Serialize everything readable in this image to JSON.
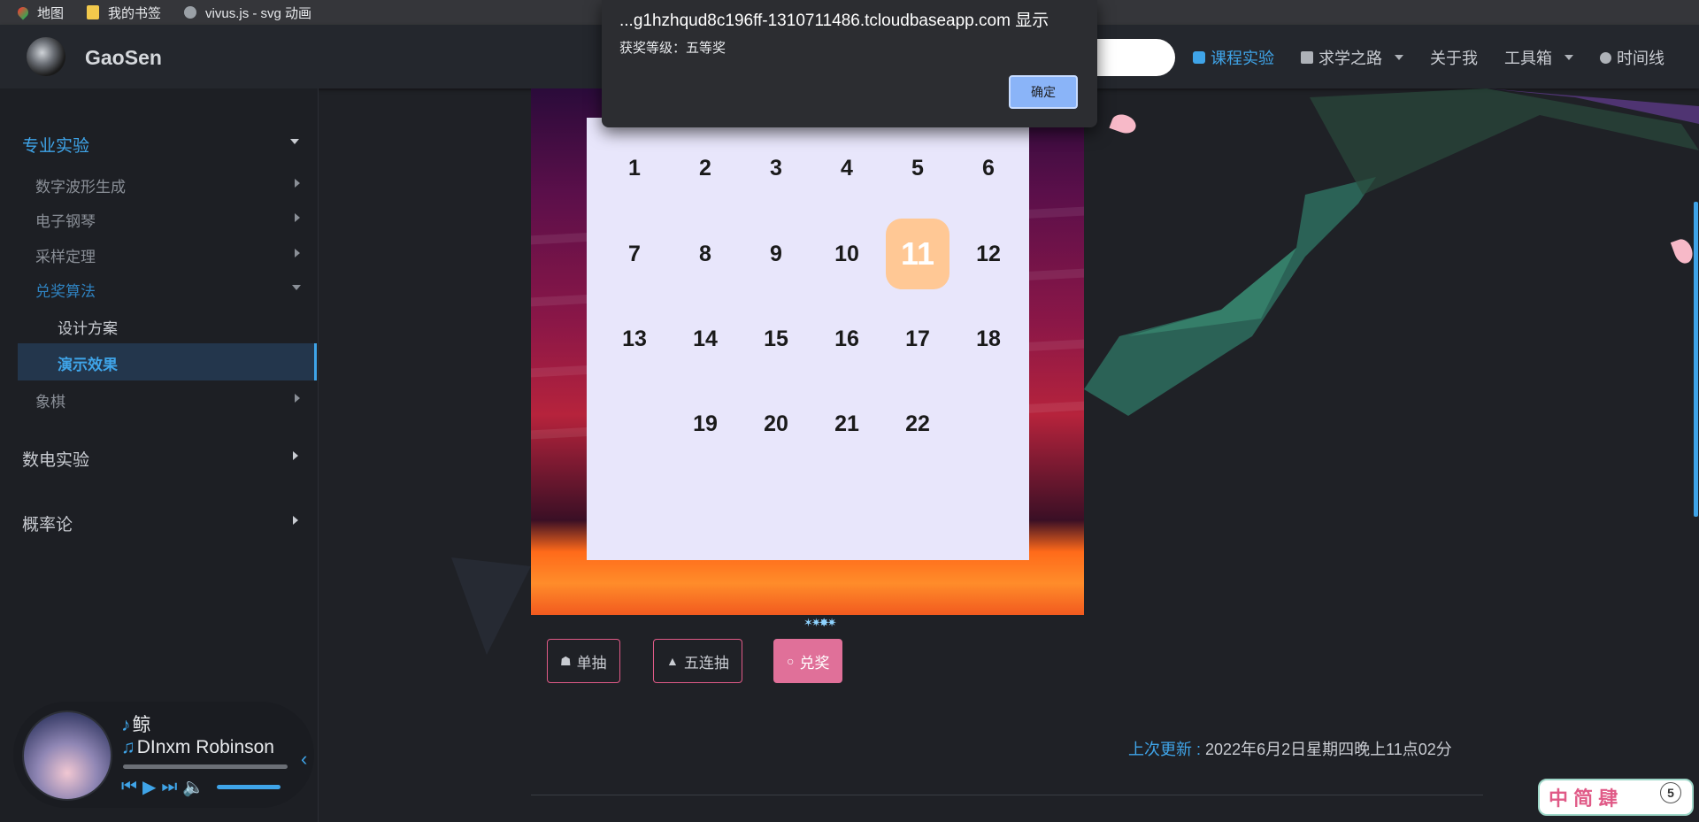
{
  "bookmarks": [
    {
      "label": "地图",
      "icon": "map-pin-icon"
    },
    {
      "label": "我的书签",
      "icon": "folder-icon"
    },
    {
      "label": "vivus.js - svg 动画",
      "icon": "globe-icon"
    }
  ],
  "header": {
    "site_title": "GaoSen",
    "nav": [
      {
        "label": "课程实验",
        "icon": "code-icon",
        "active": true
      },
      {
        "label": "求学之路",
        "icon": "book-icon",
        "dropdown": true
      },
      {
        "label": "关于我"
      },
      {
        "label": "工具箱",
        "dropdown": true
      },
      {
        "label": "时间线",
        "icon": "clock-icon"
      }
    ]
  },
  "sidebar": {
    "groups": [
      {
        "label": "专业实验",
        "open": true
      },
      {
        "label": "数电实验"
      },
      {
        "label": "概率论"
      }
    ],
    "subitems": [
      {
        "label": "数字波形生成"
      },
      {
        "label": "电子钢琴"
      },
      {
        "label": "采样定理"
      },
      {
        "label": "兑奖算法",
        "open": true
      },
      {
        "label": "象棋"
      }
    ],
    "leaves": [
      {
        "label": "设计方案"
      },
      {
        "label": "演示效果",
        "active": true
      }
    ]
  },
  "player": {
    "song": "鲸",
    "artist": "DInxm Robinson",
    "progress": 0.0,
    "volume": 1.0
  },
  "lottery": {
    "numbers": [
      "1",
      "2",
      "3",
      "4",
      "5",
      "6",
      "7",
      "8",
      "9",
      "10",
      "11",
      "12",
      "13",
      "14",
      "15",
      "16",
      "17",
      "18",
      "19",
      "20",
      "21",
      "22"
    ],
    "highlighted": "11",
    "buttons": {
      "single": "单抽",
      "five": "五连抽",
      "redeem": "兑奖"
    }
  },
  "footer": {
    "updated_label": "上次更新 :",
    "updated_value": "2022年6月2日星期四晚上11点02分"
  },
  "badge": {
    "text": "中 简 肆",
    "number": "5"
  },
  "dialog": {
    "title": "...g1hzhqud8c196ff-1310711486.tcloudbaseapp.com 显示",
    "message": "获奖等级：五等奖",
    "ok": "确定"
  },
  "colors": {
    "accent": "#3fa4e8",
    "pink": "#e07099",
    "highlight_cell": "#ffc895"
  }
}
